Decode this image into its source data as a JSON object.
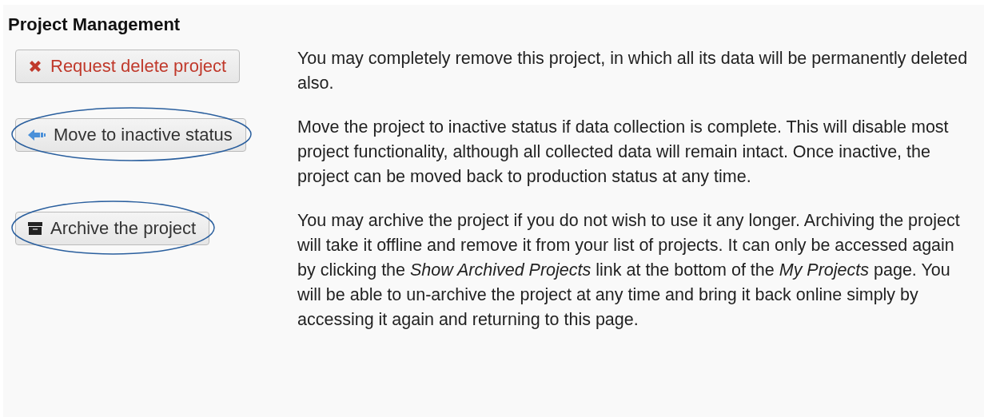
{
  "title": "Project Management",
  "actions": [
    {
      "kind": "delete",
      "label": "Request delete project",
      "circled": false,
      "description": "You may completely remove this project, in which all its data will be permanently deleted also."
    },
    {
      "kind": "inactive",
      "label": "Move to inactive status",
      "circled": true,
      "description": "Move the project to inactive status if data collection is complete. This will disable most project functionality, although all collected data will remain intact. Once inactive, the project can be moved back to production status at any time."
    },
    {
      "kind": "archive",
      "label": "Archive the project",
      "circled": true,
      "description": "You may archive the project if you do not wish to use it any longer. Archiving the project will take it offline and remove it from your list of projects. It can only be accessed again by clicking the *Show Archived Projects* link at the bottom of the *My Projects* page. You will be able to un-archive the project at any time and bring it back online simply by accessing it again and returning to this page."
    }
  ]
}
